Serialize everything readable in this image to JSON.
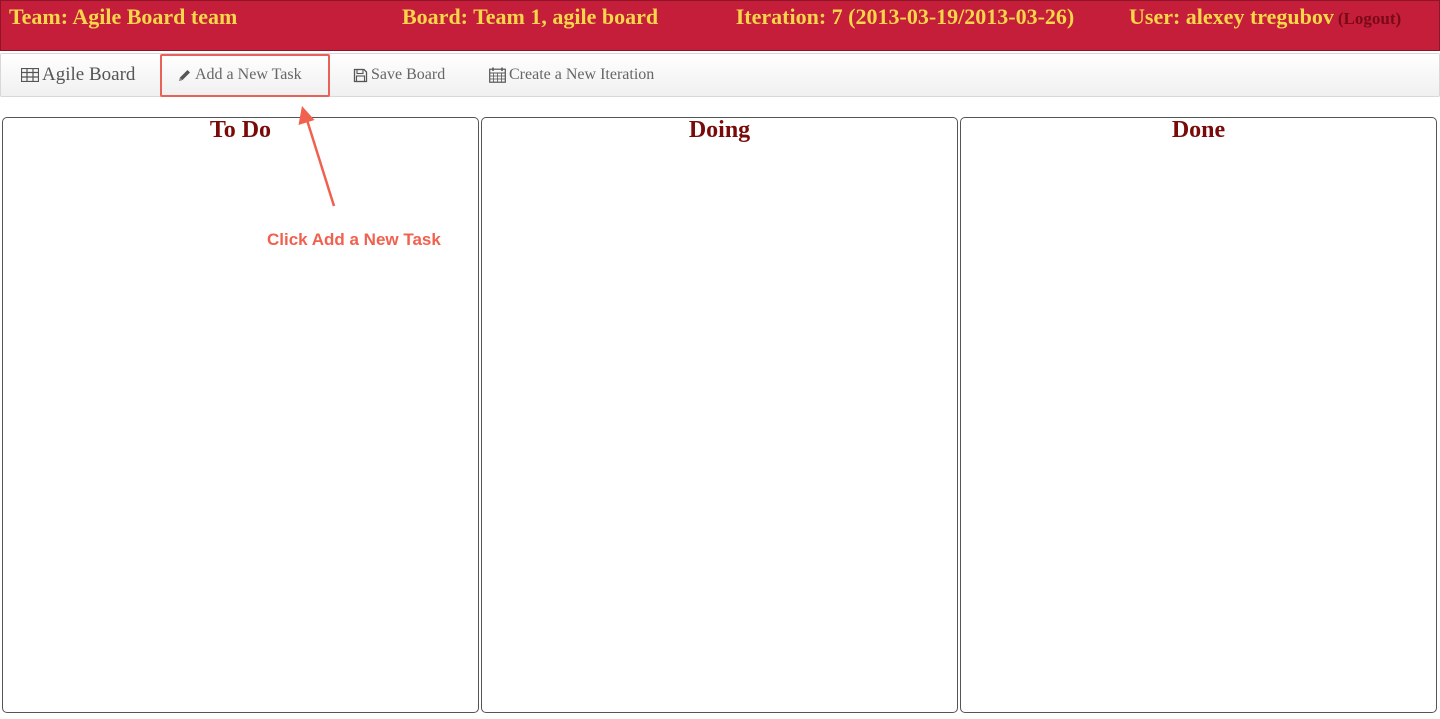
{
  "header": {
    "team": "Team: Agile Board team",
    "board": "Board: Team 1, agile board",
    "iteration": "Iteration: 7 (2013-03-19/2013-03-26)",
    "user": "User: alexey tregubov",
    "logout": "(Logout)"
  },
  "toolbar": {
    "brand": "Agile Board",
    "add_task": "Add a New Task",
    "save_board": "Save Board",
    "new_iteration": "Create a New Iteration"
  },
  "columns": {
    "todo": "To Do",
    "doing": "Doing",
    "done": "Done"
  },
  "annotation": {
    "text": "Click Add a New Task",
    "color": "#f0614f"
  },
  "colors": {
    "header_bg": "#c41e3a",
    "header_text": "#f7d64a",
    "column_title": "#7a0a0a"
  }
}
